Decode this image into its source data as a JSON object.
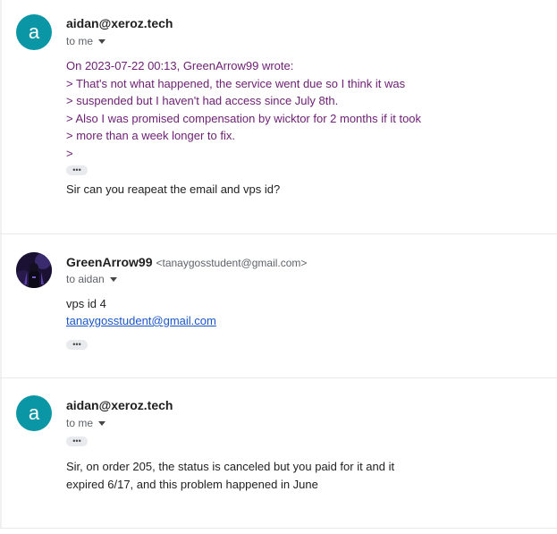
{
  "messages": [
    {
      "avatar_letter": "a",
      "sender": "aidan@xeroz.tech",
      "to": "to me",
      "quote_lines": [
        "On 2023-07-22 00:13, GreenArrow99 wrote:",
        "> That's not what happened, the service went due so I think it was",
        "> suspended but I haven't had access since July 8th.",
        "> Also I was promised compensation by wicktor for 2 months if it took",
        "> more than a week longer to fix.",
        ">"
      ],
      "more": "•••",
      "body": "Sir can you reapeat the email and vps id?"
    },
    {
      "sender": "GreenArrow99",
      "sender_email": "<tanaygosstudent@gmail.com>",
      "to": "to aidan",
      "line1": "vps id 4",
      "link": "tanaygosstudent@gmail.com",
      "more": "•••"
    },
    {
      "avatar_letter": "a",
      "sender": "aidan@xeroz.tech",
      "to": "to me",
      "more": "•••",
      "body_lines": [
        "Sir, on order 205, the status is canceled but you paid for it and it",
        "expired 6/17, and this problem happened in June"
      ]
    }
  ],
  "icons": {
    "caret": "chevron-down-icon",
    "more": "more-horizontal-icon"
  },
  "colors": {
    "avatar": "#0b96a6",
    "quote": "#6e2175",
    "link": "#1a56c8"
  }
}
